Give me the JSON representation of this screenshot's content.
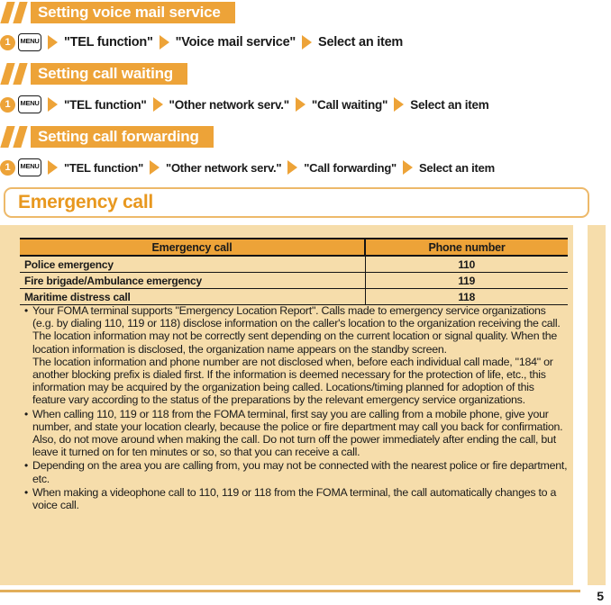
{
  "page": {
    "number": "5",
    "accent_orange": "#eda338",
    "title_orange": "#e8981f",
    "panel_beige": "#f6ddab"
  },
  "sections": [
    {
      "id": "voice-mail",
      "heading": "Setting voice mail service",
      "step": {
        "number": "1",
        "key_label": "MENU",
        "items": [
          "\"TEL function\"",
          "\"Voice mail service\"",
          "Select an item"
        ]
      }
    },
    {
      "id": "call-waiting",
      "heading": "Setting call waiting",
      "step": {
        "number": "1",
        "key_label": "MENU",
        "items": [
          "\"TEL function\"",
          "\"Other network serv.\"",
          "\"Call waiting\"",
          "Select an item"
        ]
      }
    },
    {
      "id": "call-forwarding",
      "heading": "Setting call forwarding",
      "step": {
        "number": "1",
        "key_label": "MENU",
        "items": [
          "\"TEL function\"",
          "\"Other network serv.\"",
          "\"Call forwarding\"",
          "Select an item"
        ]
      }
    }
  ],
  "emergency": {
    "title": "Emergency call",
    "table": {
      "headers": [
        "Emergency call",
        "Phone number"
      ],
      "rows": [
        [
          "Police emergency",
          "110"
        ],
        [
          "Fire brigade/Ambulance emergency",
          "119"
        ],
        [
          "Maritime distress call",
          "118"
        ]
      ]
    },
    "bullet_char": "•",
    "notes": [
      {
        "paragraphs": [
          "Your FOMA terminal supports \"Emergency Location Report\". Calls made to emergency service organizations (e.g. by dialing 110, 119 or 118) disclose information on the caller's location to the organization receiving the call. The location information may not be correctly sent depending on the current location or signal quality. When the location information is disclosed, the organization name appears on the standby screen.",
          "The location information and phone number are not disclosed when, before each individual call made, \"184\" or another blocking prefix is dialed first. If the information is deemed necessary for the protection of life, etc., this information may be acquired by the organization being called. Locations/timing planned for adoption of this feature vary according to the status of the preparations by the relevant emergency service organizations."
        ]
      },
      {
        "paragraphs": [
          "When calling 110, 119 or 118 from the FOMA terminal, first say you are calling from a mobile phone, give your number, and state your location clearly, because the police or fire department may call you back for confirmation. Also, do not move around when making the call. Do not turn off the power immediately after ending the call, but leave it turned on for ten minutes or so, so that you can receive a call."
        ]
      },
      {
        "paragraphs": [
          "Depending on the area you are calling from, you may not be connected with the nearest police or fire department, etc."
        ]
      },
      {
        "paragraphs": [
          "When making a videophone call to 110, 119 or 118 from the FOMA terminal, the call automatically changes to a voice call."
        ]
      }
    ]
  }
}
